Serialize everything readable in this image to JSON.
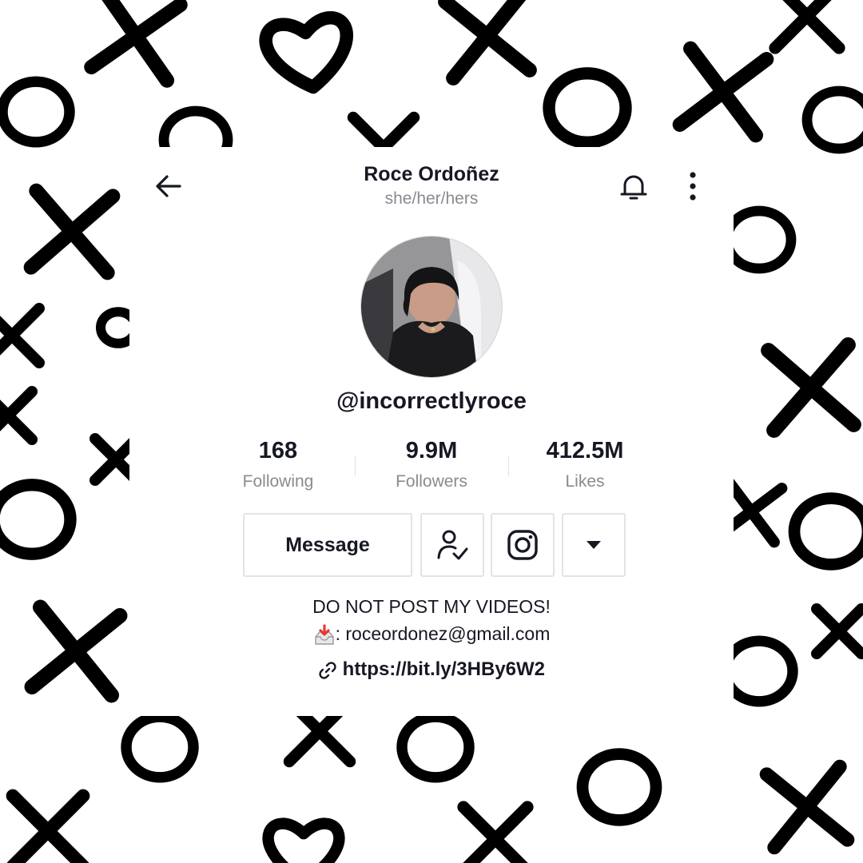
{
  "header": {
    "display_name": "Roce Ordoñez",
    "pronouns": "she/her/hers",
    "back_icon": "arrow-left-icon",
    "notifications_icon": "bell-icon",
    "more_icon": "vertical-dots-icon"
  },
  "profile": {
    "username": "@incorrectlyroce",
    "avatar_icon": "profile-photo"
  },
  "stats": [
    {
      "value": "168",
      "label": "Following"
    },
    {
      "value": "9.9M",
      "label": "Followers"
    },
    {
      "value": "412.5M",
      "label": "Likes"
    }
  ],
  "actions": {
    "message_label": "Message",
    "following_icon": "person-check-icon",
    "instagram_icon": "instagram-icon",
    "dropdown_icon": "caret-down-icon"
  },
  "bio": {
    "line1": "DO NOT POST MY VIDEOS!",
    "email_prefix": ":",
    "email": "roceordonez@gmail.com",
    "email_icon": "inbox-tray-icon",
    "link_icon": "link-icon",
    "link": "https://bit.ly/3HBy6W2"
  },
  "background": {
    "pattern": "xo-hearts",
    "colors": {
      "ink": "#000000",
      "paper": "#ffffff"
    }
  },
  "colors": {
    "text_primary": "#161823",
    "text_secondary": "#8a8b91",
    "border": "#e3e3e4",
    "inbox_red": "#e53935"
  }
}
